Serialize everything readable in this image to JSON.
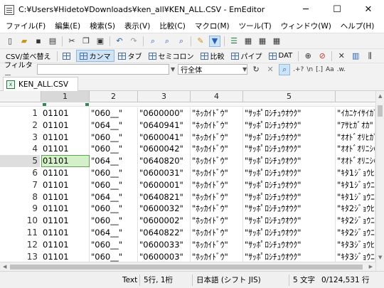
{
  "window": {
    "title": "C:¥Users¥Hideto¥Downloads¥ken_all¥KEN_ALL.CSV - EmEditor",
    "minimize": "─",
    "maximize": "☐",
    "close": "✕"
  },
  "menu": [
    "ファイル(F)",
    "編集(E)",
    "検索(S)",
    "表示(V)",
    "比較(C)",
    "マクロ(M)",
    "ツール(T)",
    "ウィンドウ(W)",
    "ヘルプ(H)"
  ],
  "toolbar2": {
    "csv_label": "CSV/並べ替え",
    "comma": "カンマ",
    "tab": "タブ",
    "semicolon": "セミコロン",
    "compare": "比較",
    "pipe": "パイプ",
    "dat": "DAT"
  },
  "filter": {
    "label": "フィルター",
    "scope": "行全体",
    "regex_label": ".+?",
    "n_label": "\\n",
    "bracket_label": "[.]",
    "case_label": "Aa",
    "word_label": ".w."
  },
  "tab": {
    "name": "KEN_ALL.CSV"
  },
  "columns": [
    "1",
    "2",
    "3",
    "4",
    "5"
  ],
  "rows": [
    {
      "num": "1",
      "c1": "01101",
      "c2": "\"060__\"",
      "c3": "\"0600000\"",
      "c4": "\"ﾎｯｶｲﾄﾞｳ\"",
      "c5": "\"ｻｯﾎﾟﾛｼﾁｭｳｵｳｸ\"",
      "c6": "\"ｲｶﾆｹｲｻｲｶﾞ"
    },
    {
      "num": "2",
      "c1": "01101",
      "c2": "\"064__\"",
      "c3": "\"0640941\"",
      "c4": "\"ﾎｯｶｲﾄﾞｳ\"",
      "c5": "\"ｻｯﾎﾟﾛｼﾁｭｳｵｳｸ\"",
      "c6": "\"ｱｻﾋｶﾞｵｶ\""
    },
    {
      "num": "3",
      "c1": "01101",
      "c2": "\"060__\"",
      "c3": "\"0600041\"",
      "c4": "\"ﾎｯｶｲﾄﾞｳ\"",
      "c5": "\"ｻｯﾎﾟﾛｼﾁｭｳｵｳｸ\"",
      "c6": "\"ｵｵﾄﾞｵﾘﾋｶﾞ"
    },
    {
      "num": "4",
      "c1": "01101",
      "c2": "\"060__\"",
      "c3": "\"0600042\"",
      "c4": "\"ﾎｯｶｲﾄﾞｳ\"",
      "c5": "\"ｻｯﾎﾟﾛｼﾁｭｳｵｳｸ\"",
      "c6": "\"ｵｵﾄﾞｵﾘﾆｼ("
    },
    {
      "num": "5",
      "c1": "01101",
      "c2": "\"064__\"",
      "c3": "\"0640820\"",
      "c4": "\"ﾎｯｶｲﾄﾞｳ\"",
      "c5": "\"ｻｯﾎﾟﾛｼﾁｭｳｵｳｸ\"",
      "c6": "\"ｵｵﾄﾞｵﾘﾆｼ("
    },
    {
      "num": "6",
      "c1": "01101",
      "c2": "\"060__\"",
      "c3": "\"0600031\"",
      "c4": "\"ﾎｯｶｲﾄﾞｳ\"",
      "c5": "\"ｻｯﾎﾟﾛｼﾁｭｳｵｳｸ\"",
      "c6": "\"ｷﾀ1ｼﾞｮｳﾋｶ"
    },
    {
      "num": "7",
      "c1": "01101",
      "c2": "\"060__\"",
      "c3": "\"0600001\"",
      "c4": "\"ﾎｯｶｲﾄﾞｳ\"",
      "c5": "\"ｻｯﾎﾟﾛｼﾁｭｳｵｳｸ\"",
      "c6": "\"ｷﾀ1ｼﾞｮｳﾆｼ"
    },
    {
      "num": "8",
      "c1": "01101",
      "c2": "\"064__\"",
      "c3": "\"0640821\"",
      "c4": "\"ﾎｯｶｲﾄﾞｳ\"",
      "c5": "\"ｻｯﾎﾟﾛｼﾁｭｳｵｳｸ\"",
      "c6": "\"ｷﾀ1ｼﾞｮｳﾆｼ"
    },
    {
      "num": "9",
      "c1": "01101",
      "c2": "\"060__\"",
      "c3": "\"0600032\"",
      "c4": "\"ﾎｯｶｲﾄﾞｳ\"",
      "c5": "\"ｻｯﾎﾟﾛｼﾁｭｳｵｳｸ\"",
      "c6": "\"ｷﾀ2ｼﾞｮｳﾋｶ"
    },
    {
      "num": "10",
      "c1": "01101",
      "c2": "\"060__\"",
      "c3": "\"0600002\"",
      "c4": "\"ﾎｯｶｲﾄﾞｳ\"",
      "c5": "\"ｻｯﾎﾟﾛｼﾁｭｳｵｳｸ\"",
      "c6": "\"ｷﾀ2ｼﾞｮｳﾆｼ"
    },
    {
      "num": "11",
      "c1": "01101",
      "c2": "\"064__\"",
      "c3": "\"0640822\"",
      "c4": "\"ﾎｯｶｲﾄﾞｳ\"",
      "c5": "\"ｻｯﾎﾟﾛｼﾁｭｳｵｳｸ\"",
      "c6": "\"ｷﾀ2ｼﾞｮｳﾆｼ"
    },
    {
      "num": "12",
      "c1": "01101",
      "c2": "\"060__\"",
      "c3": "\"0600033\"",
      "c4": "\"ﾎｯｶｲﾄﾞｳ\"",
      "c5": "\"ｻｯﾎﾟﾛｼﾁｭｳｵｳｸ\"",
      "c6": "\"ｷﾀ3ｼﾞｮｳﾋｶ"
    },
    {
      "num": "13",
      "c1": "01101",
      "c2": "\"060__\"",
      "c3": "\"0600003\"",
      "c4": "\"ﾎｯｶｲﾄﾞｳ\"",
      "c5": "\"ｻｯﾎﾟﾛｼﾁｭｳｵｳｸ\"",
      "c6": "\"ｷﾀ3ｼﾞｮｳﾆｼ"
    }
  ],
  "status": {
    "mode": "Text",
    "position": "5行, 1桁",
    "encoding": "日本語 (シフト JIS)",
    "selection": "5 文字",
    "lines": "0/124,531 行"
  },
  "colors": {
    "accent": "#cfe3f7",
    "selection_fill": "#d4f0c8",
    "selection_border": "#5aa653"
  }
}
